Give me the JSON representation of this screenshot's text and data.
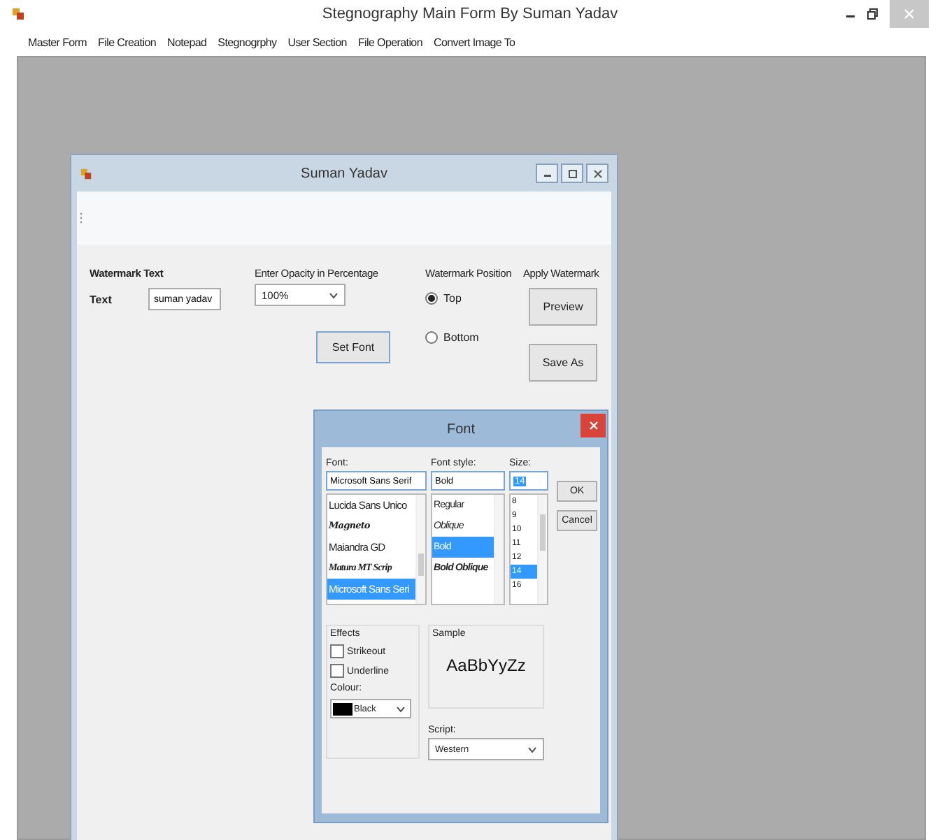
{
  "window": {
    "title": "Stegnography Main Form By Suman Yadav"
  },
  "menu": [
    "Master Form",
    "File Creation",
    "Notepad",
    "Stegnogrphy",
    "User Section",
    "File Operation",
    "Convert Image To"
  ],
  "child_window": {
    "title": "Suman Yadav",
    "watermark_heading": "Watermark Text",
    "text_label": "Text",
    "text_value": "suman yadav",
    "opacity_label": "Enter Opacity in Percentage",
    "opacity_value": "100%",
    "set_font_button": "Set Font",
    "position_label": "Watermark Position",
    "positions": [
      {
        "label": "Top",
        "selected": true
      },
      {
        "label": "Bottom",
        "selected": false
      }
    ],
    "apply_label": "Apply Watermark",
    "buttons": [
      "Preview",
      "Save As"
    ]
  },
  "font_dialog": {
    "title": "Font",
    "font_label": "Font:",
    "font_value": "Microsoft Sans Serif",
    "style_label": "Font style:",
    "style_value": "Bold",
    "size_label": "Size:",
    "size_value": "14",
    "fonts": [
      {
        "label": "Lucida Sans Unico",
        "kind": "regular",
        "selected": false
      },
      {
        "label": "Magneto",
        "kind": "script",
        "selected": false
      },
      {
        "label": "Maiandra GD",
        "kind": "regular",
        "selected": false
      },
      {
        "label": "Matura MT Scrip",
        "kind": "decorative",
        "selected": false
      },
      {
        "label": "Microsoft Sans Seri",
        "kind": "regular",
        "selected": true
      }
    ],
    "styles": [
      {
        "label": "Regular",
        "kind": "regular",
        "selected": false
      },
      {
        "label": "Oblique",
        "kind": "italic",
        "selected": false
      },
      {
        "label": "Bold",
        "kind": "bold",
        "selected": true
      },
      {
        "label": "Bold Oblique",
        "kind": "bold-italic",
        "selected": false
      }
    ],
    "sizes": [
      {
        "label": "8",
        "selected": false
      },
      {
        "label": "9",
        "selected": false
      },
      {
        "label": "10",
        "selected": false
      },
      {
        "label": "11",
        "selected": false
      },
      {
        "label": "12",
        "selected": false
      },
      {
        "label": "14",
        "selected": true
      },
      {
        "label": "16",
        "selected": false
      }
    ],
    "buttons": [
      "OK",
      "Cancel"
    ],
    "effects_heading": "Effects",
    "effects": [
      {
        "label": "Strikeout",
        "checked": false
      },
      {
        "label": "Underline",
        "checked": false
      }
    ],
    "colour_label": "Colour:",
    "colour_value": "Black",
    "sample_heading": "Sample",
    "sample_text": "AaBbYyZz",
    "script_label": "Script:",
    "script_value": "Western"
  }
}
